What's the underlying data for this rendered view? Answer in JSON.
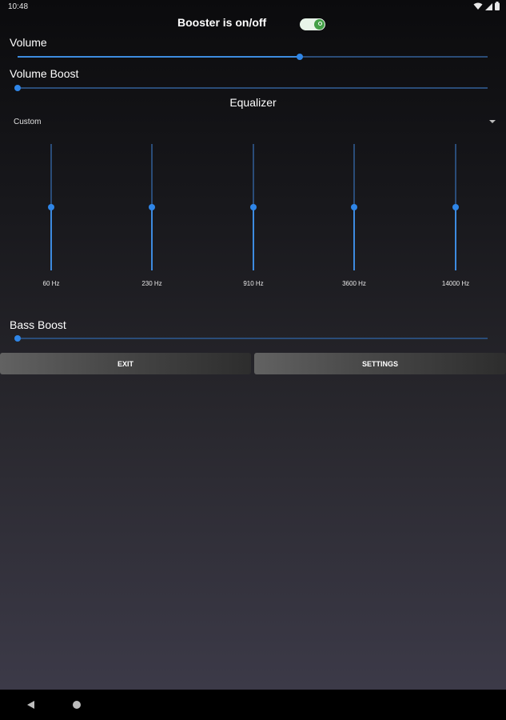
{
  "status_bar": {
    "time": "10:48",
    "icons": [
      "wifi-icon",
      "signal-icon",
      "battery-icon"
    ]
  },
  "booster": {
    "label": "Booster is on/off",
    "enabled": true
  },
  "volume": {
    "label": "Volume",
    "level": 0.6
  },
  "volume_boost": {
    "label": "Volume Boost",
    "level": 0.0
  },
  "equalizer": {
    "title": "Equalizer",
    "preset": "Custom",
    "bands": [
      {
        "freq": "60 Hz",
        "level": 0.5
      },
      {
        "freq": "230 Hz",
        "level": 0.5
      },
      {
        "freq": "910 Hz",
        "level": 0.5
      },
      {
        "freq": "3600 Hz",
        "level": 0.5
      },
      {
        "freq": "14000 Hz",
        "level": 0.5
      }
    ]
  },
  "bass_boost": {
    "label": "Bass Boost",
    "level": 0.0
  },
  "buttons": {
    "exit": "EXIT",
    "settings": "SETTINGS"
  },
  "colors": {
    "accent": "#2f86e8",
    "toggle_on": "#43a047"
  }
}
